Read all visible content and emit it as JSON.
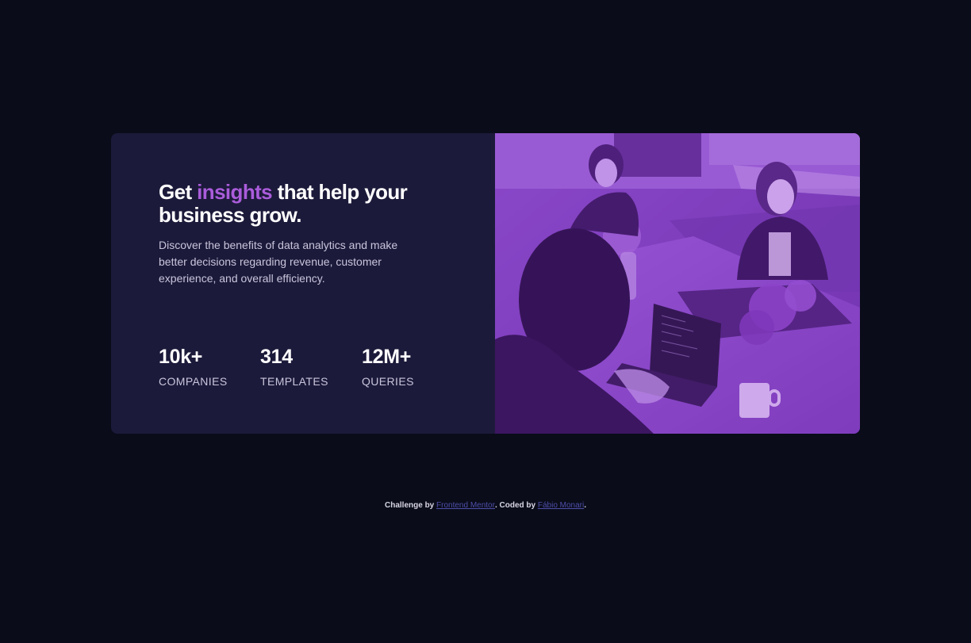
{
  "card": {
    "headline_before": "Get ",
    "headline_accent": "insights",
    "headline_after": " that help your business grow.",
    "description": "Discover the benefits of data analytics and make better decisions regarding revenue, customer experience, and overall efficiency.",
    "stats": [
      {
        "value": "10k+",
        "label": "COMPANIES"
      },
      {
        "value": "314",
        "label": "TEMPLATES"
      },
      {
        "value": "12M+",
        "label": "QUERIES"
      }
    ],
    "image_alt": "People working at a table with laptops"
  },
  "footer": {
    "challenge_text": "Challenge by ",
    "challenge_link": "Frontend Mentor",
    "coded_text": ". Coded by ",
    "coded_link": "Fábio Monari",
    "end_text": "."
  },
  "colors": {
    "page_bg": "#0a0c1a",
    "card_bg": "#1c1a3a",
    "accent": "#aa5cdb",
    "image_tint": "#7b3fb6"
  }
}
